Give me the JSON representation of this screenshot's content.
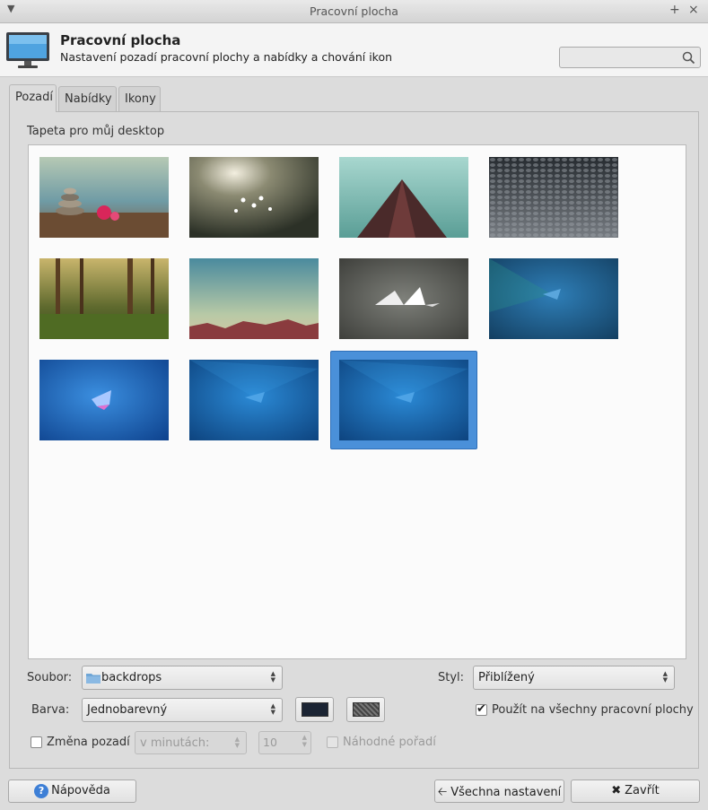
{
  "window": {
    "title": "Pracovní plocha"
  },
  "header": {
    "title": "Pracovní plocha",
    "subtitle": "Nastavení pozadí pracovní plochy a nabídky a chování ikon",
    "search_placeholder": ""
  },
  "tabs": [
    {
      "label": "Pozadí",
      "active": true
    },
    {
      "label": "Nabídky",
      "active": false
    },
    {
      "label": "Ikony",
      "active": false
    }
  ],
  "background": {
    "group_label": "Tapeta pro můj desktop",
    "wallpapers": [
      {
        "name": "stones-flower"
      },
      {
        "name": "flowers-bokeh"
      },
      {
        "name": "mountain-peak"
      },
      {
        "name": "pebbles"
      },
      {
        "name": "forest"
      },
      {
        "name": "desert-horizon"
      },
      {
        "name": "paper-mountains"
      },
      {
        "name": "xfce-blue-green"
      },
      {
        "name": "xfce-blue-1"
      },
      {
        "name": "xfce-blue-2"
      },
      {
        "name": "xfce-blue-3",
        "selected": true
      }
    ],
    "file_label": "Soubor:",
    "file_value": "backdrops",
    "style_label": "Styl:",
    "style_value": "Přiblížený",
    "color_label": "Barva:",
    "color_value": "Jednobarevný",
    "primary_color": "#1b2433",
    "apply_all_label": "Použít na všechny pracovní plochy",
    "apply_all_checked": true,
    "change_label": "Změna pozadí",
    "change_checked": false,
    "interval_unit": "v minutách:",
    "interval_value": "10",
    "random_label": "Náhodné pořadí",
    "random_checked": false
  },
  "footer": {
    "help_label": "Nápověda",
    "all_settings_label": "Všechna nastavení",
    "close_label": "Zavřít"
  }
}
